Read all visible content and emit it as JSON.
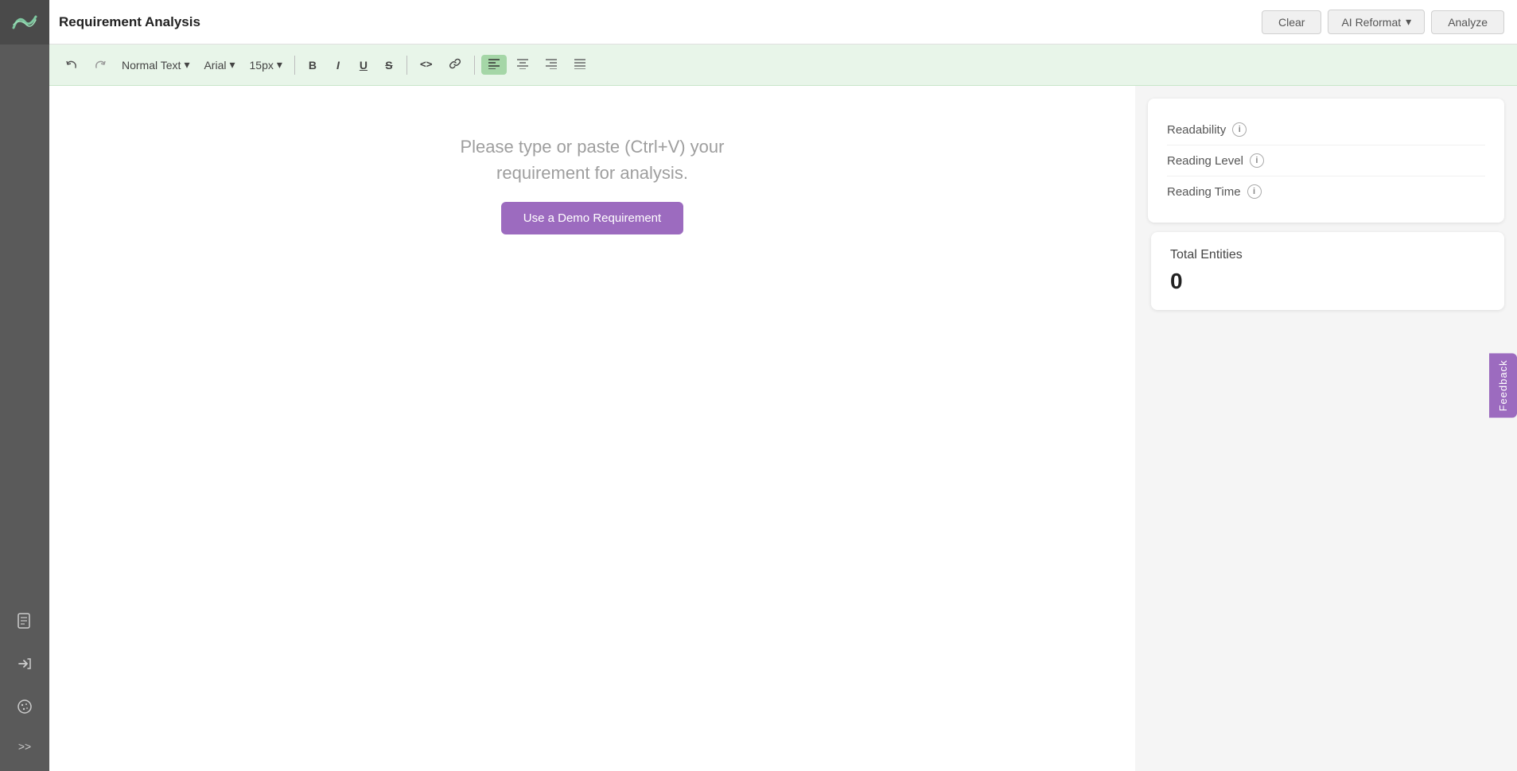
{
  "app": {
    "title": "Requirement Analysis"
  },
  "header": {
    "clear_label": "Clear",
    "ai_reformat_label": "AI Reformat",
    "analyze_label": "Analyze",
    "dropdown_arrow": "▾"
  },
  "toolbar": {
    "text_style_label": "Normal Text",
    "text_style_arrow": "▾",
    "font_family_label": "Arial",
    "font_family_arrow": "▾",
    "font_size_label": "15px",
    "font_size_arrow": "▾",
    "bold_label": "B",
    "italic_label": "I",
    "underline_label": "U",
    "strikethrough_label": "S",
    "code_label": "<>",
    "link_label": "🔗",
    "align_left": "≡",
    "align_center": "≡",
    "align_right": "≡",
    "align_justify": "≡"
  },
  "editor": {
    "placeholder_line1": "Please type or paste (Ctrl+V) your",
    "placeholder_line2": "requirement for analysis.",
    "demo_btn_label": "Use a Demo Requirement"
  },
  "readability_panel": {
    "title": "Readability",
    "rows": [
      {
        "label": "Readability"
      },
      {
        "label": "Reading Level"
      },
      {
        "label": "Reading Time"
      }
    ]
  },
  "entities_panel": {
    "title": "Total Entities",
    "count": "0"
  },
  "feedback": {
    "label": "Feedback"
  },
  "sidebar": {
    "items": [
      {
        "name": "document-icon",
        "unicode": "📄"
      },
      {
        "name": "export-icon",
        "unicode": "➜"
      },
      {
        "name": "cookie-icon",
        "unicode": "🍪"
      }
    ],
    "expand_label": ">>"
  },
  "colors": {
    "purple": "#9c6bbf",
    "toolbar_bg": "#e8f5e9",
    "sidebar_bg": "#5a5a5a"
  }
}
